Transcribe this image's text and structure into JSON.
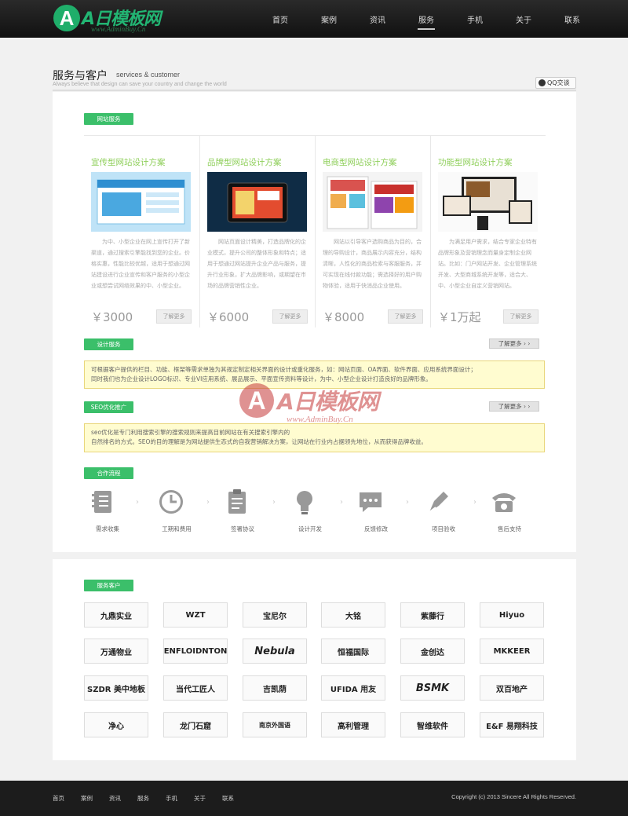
{
  "header": {
    "logo_mark": "A",
    "logo_text": "A日模板网",
    "logo_sub": "www.AdminBuy.Cn",
    "nav": [
      "首页",
      "案例",
      "资讯",
      "服务",
      "手机",
      "关于",
      "联系"
    ],
    "active_nav": "服务"
  },
  "page": {
    "title": "服务与客户",
    "title_en": "services & customer",
    "subtitle": "Always believe that design can save your country and change the world",
    "qq_label": "QQ交谈"
  },
  "sections": {
    "web_service": "网站服务",
    "design_service": "设计服务",
    "seo": "SEO优化推广",
    "process": "合作流程",
    "clients": "服务客户",
    "more": "了解更多 › ›"
  },
  "solutions": [
    {
      "title": "宣传型网站设计方案",
      "desc": "为中、小型企业在网上宣传打开了新渠道，通过搜索引擎能找到您的企业。价格实惠，性能比较优越，适用于想通过网站建设进行企业宣传和客户服务的小型企业或想尝试网络效果的中、小型企业。",
      "price": "￥3000",
      "more": "了解更多"
    },
    {
      "title": "品牌型网站设计方案",
      "desc": "网站页面设计精美，打造品牌化的企业模式，提升公司的整体形象和特点；适用于想通过网站提升企业产品与服务，提升行业形象，扩大品牌影响，或期望在市场的品牌营销性企业。",
      "price": "￥6000",
      "more": "了解更多"
    },
    {
      "title": "电商型网站设计方案",
      "desc": "网站以引导客户选购商品为目的，合理的导购设计，商品展示内容充分，结构清晰，人性化的商品检索与客服服务，并可实现在线付款功能；需选择好的用户购物体验，适用于快消品企业使用。",
      "price": "￥8000",
      "more": "了解更多"
    },
    {
      "title": "功能型网站设计方案",
      "desc": "为满足用户需求，结合专家企业特有品牌形象及营销理念而量身定制企业网站。比如：门户网站开发、企业管理系统开发、大型商城系统开发等，适合大、中、小型企业自定义营销网站。",
      "price": "￥1万起",
      "more": "了解更多"
    }
  ],
  "design_text": "可根据客户提供的栏目、功能、框架等需求单独为其规定制定相关界面的设计或重化服务，如：网站页面、OA界面、软件界面、应用系统界面设计；\n同时我们也为企业设计LOGO标识、专业VI应用系统、展品展示、平面宣传资料等设计，为中、小型企业设计打造良好的品牌形象。",
  "seo_text": "seo优化是专门利用搜索引擎的搜索规则来提高目前网站在有关搜索引擎内的\n自然排名的方式。SEO的目的理解是为网站提供生态式的自我营销解决方案，让网站在行业内占据领先地位，从而获得品牌收益。",
  "process_steps": [
    "需求收集",
    "工期和费用",
    "签署协议",
    "设计开发",
    "反馈修改",
    "项目验收",
    "售后支持"
  ],
  "clients": [
    "九鼎实业",
    "WZT",
    "宝尼尔",
    "大铭",
    "紫藤行",
    "Hiyuo",
    "万通物业",
    "ENFLOIDNTON",
    "Nebula",
    "恒福国际",
    "金创达",
    "MKKEER",
    "SZDR 美中地板",
    "当代工匠人",
    "吉凯荫",
    "UFIDA 用友",
    "BSMK",
    "双百地产",
    "净心",
    "龙门石窟",
    "南京外国语",
    "高利管理",
    "智维软件",
    "E&F 易翔科技"
  ],
  "watermark": {
    "mark": "A",
    "text": "A日模板网",
    "sub": "www.AdminBuy.Cn"
  },
  "footer": {
    "links": [
      "首页",
      "案例",
      "资讯",
      "服务",
      "手机",
      "关于",
      "联系"
    ],
    "copyright": "Copyright (c) 2013 Sincere All Rights Reserved."
  }
}
